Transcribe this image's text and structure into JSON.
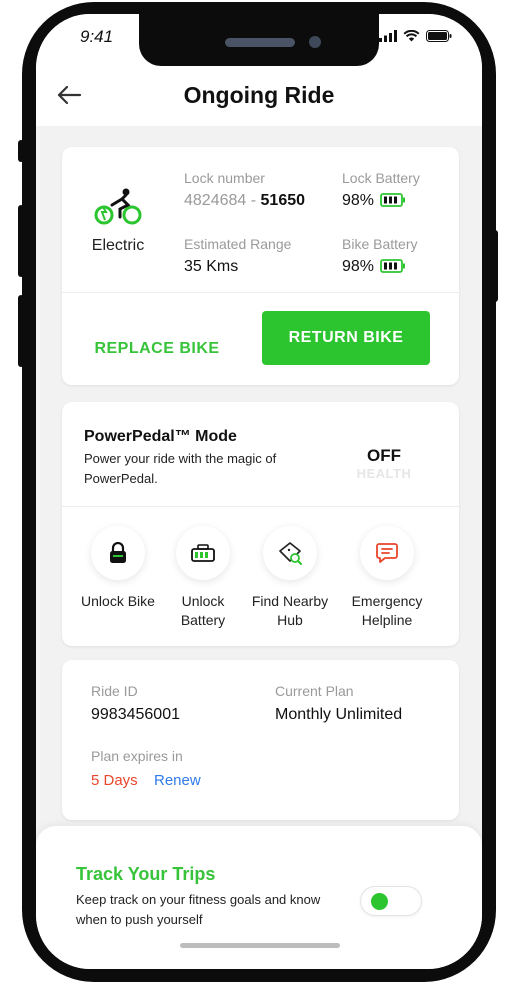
{
  "status_bar": {
    "time": "9:41"
  },
  "header": {
    "title": "Ongoing Ride"
  },
  "ride_card": {
    "bike_type": "Electric",
    "lock_number_label": "Lock number",
    "lock_number_prefix": "4824684 - ",
    "lock_number_suffix": "51650",
    "lock_battery_label": "Lock Battery",
    "lock_battery_value": "98%",
    "range_label": "Estimated Range",
    "range_value": "35 Kms",
    "bike_battery_label": "Bike Battery",
    "bike_battery_value": "98%",
    "replace_label": "REPLACE BIKE",
    "return_label": "RETURN BIKE"
  },
  "powerpedal": {
    "title": "PowerPedal™ Mode",
    "description": "Power your ride with the magic of PowerPedal.",
    "state": "OFF",
    "mode": "HEALTH"
  },
  "actions": [
    {
      "label": "Unlock Bike",
      "icon": "lock-icon"
    },
    {
      "label": "Unlock Battery",
      "icon": "battery-icon"
    },
    {
      "label": "Find Nearby Hub",
      "icon": "map-location-icon"
    },
    {
      "label": "Emergency Helpline",
      "icon": "chat-alert-icon"
    }
  ],
  "ride_info": {
    "ride_id_label": "Ride ID",
    "ride_id": "9983456001",
    "plan_label": "Current Plan",
    "plan": "Monthly Unlimited",
    "expires_label": "Plan expires in",
    "expires_value": "5 Days",
    "renew_label": "Renew"
  },
  "track_trips": {
    "title": "Track Your Trips",
    "description": "Keep track on your fitness goals and know when to push yourself",
    "toggle_on": true
  },
  "colors": {
    "accent_green": "#2cc52f",
    "expiry_red": "#e8462a",
    "link_blue": "#2f7bea"
  }
}
